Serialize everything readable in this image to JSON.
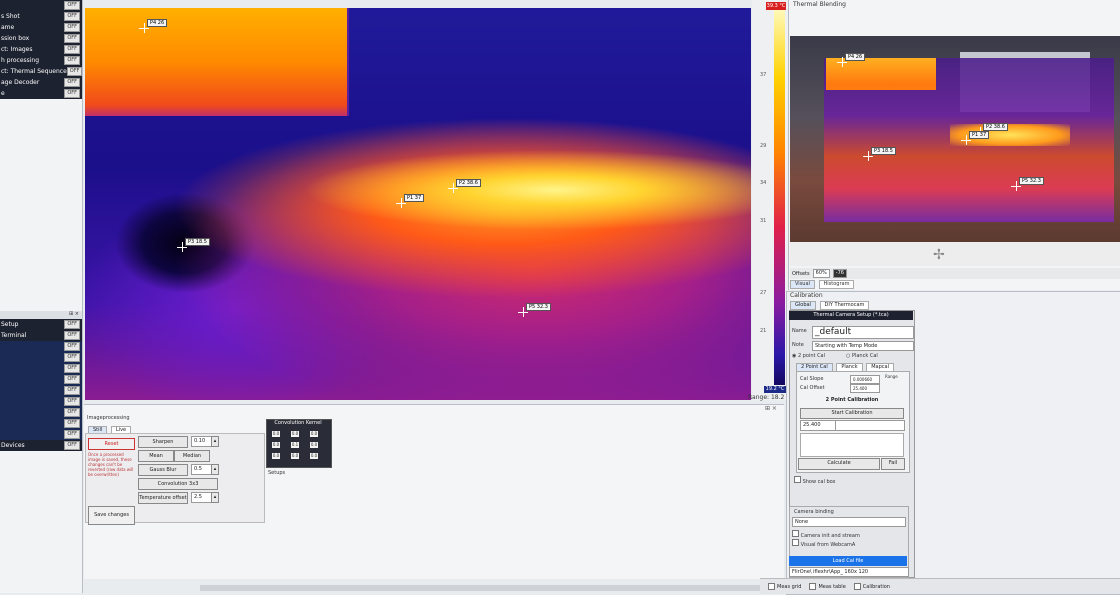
{
  "left_panel": {
    "items_top": [
      {
        "label": "",
        "state": "OFF"
      },
      {
        "label": "s Shot",
        "state": "OFF"
      },
      {
        "label": "ame",
        "state": "OFF"
      },
      {
        "label": "ssion box",
        "state": "OFF"
      },
      {
        "label": "ct: Images",
        "state": "OFF"
      },
      {
        "label": "h processing",
        "state": "OFF"
      },
      {
        "label": "ct: Thermal Sequence",
        "state": "OFF"
      },
      {
        "label": "age Decoder",
        "state": "OFF"
      },
      {
        "label": "e",
        "state": "OFF"
      }
    ],
    "items_bottom": [
      {
        "label": "Setup",
        "state": "OFF"
      },
      {
        "label": "Terminal",
        "state": "OFF"
      },
      {
        "label": "",
        "state": "OFF"
      },
      {
        "label": "",
        "state": "OFF"
      },
      {
        "label": "",
        "state": "OFF"
      },
      {
        "label": "",
        "state": "OFF"
      },
      {
        "label": "",
        "state": "OFF"
      },
      {
        "label": "",
        "state": "OFF"
      },
      {
        "label": "",
        "state": "OFF"
      },
      {
        "label": "",
        "state": "OFF"
      },
      {
        "label": "",
        "state": "OFF"
      },
      {
        "label": "Devices",
        "state": "OFF"
      }
    ]
  },
  "thermal_view": {
    "pins": [
      {
        "id": "P4",
        "label": "P4",
        "value": "26"
      },
      {
        "id": "P2",
        "label": "P2",
        "value": "38.6"
      },
      {
        "id": "P1",
        "label": "P1",
        "value": "37"
      },
      {
        "id": "P3",
        "label": "P3",
        "value": "18.5"
      },
      {
        "id": "P5",
        "label": "P5",
        "value": "32.3"
      }
    ]
  },
  "scale": {
    "max": "39.3 °C",
    "min": "19.2 °C",
    "ticks": [
      "37",
      "34",
      "29",
      "31",
      "27",
      "21"
    ],
    "range_label": "Range",
    "range_value": "18.2"
  },
  "blending": {
    "title": "Thermal Blending",
    "pins": [
      {
        "label": "P4",
        "value": "26"
      },
      {
        "label": "P2",
        "value": "38.6"
      },
      {
        "label": "P1",
        "value": "37"
      },
      {
        "label": "P3",
        "value": "18.5"
      },
      {
        "label": "P5",
        "value": "32.3"
      }
    ],
    "offsets_label": "Offsets",
    "offset_value": "60%",
    "zoom_value": "-76",
    "tabs": [
      "Visual",
      "Histogram"
    ]
  },
  "calibration": {
    "header": "Calibration",
    "tabs": [
      "Global",
      "DIY Thermocam"
    ],
    "box_title": "Thermal Camera Setup (*.tca)",
    "name_label": "Name",
    "name_value": "_default",
    "note_label": "Note",
    "note_value": "Starting with Temp Mode",
    "mode_options": [
      "2 point Cal",
      "Planck Cal"
    ],
    "subtabs": [
      "2 Point Cal",
      "Planck",
      "Mapcal"
    ],
    "cal_slope_label": "Cal Slope",
    "cal_slope_value": "0.000660",
    "cal_offset_label": "Cal Offset",
    "cal_offset_value": "25.400",
    "range_label": "Range",
    "section_title": "2 Point Calibration",
    "start_btn": "Start Calibration",
    "temp_value": "25.400",
    "calculate_btn": "Calculate",
    "fail_btn": "Fail",
    "show_cal_box": "Show cal box",
    "camera_binding_label": "Camera binding",
    "camera_binding_value": "None",
    "camera_init": "Camera init and stream",
    "visual_from": "Visual from WebcamA",
    "load_btn": "Load Cal file",
    "path_value": "FlirOne\\ iflexhr\\App_ 160x 120"
  },
  "image_processing": {
    "header": "Imageprocessing",
    "tabs": [
      "Still",
      "Live"
    ],
    "reset_btn": "Reset",
    "note": "Once a processed image is saved, these changes can't be reverted (raw data will be overwritten)",
    "save_btn": "Save changes",
    "controls": [
      {
        "label": "Sharpen",
        "value": "0.10"
      },
      {
        "label": "Mean",
        "value": ""
      },
      {
        "label": "Median",
        "value": ""
      },
      {
        "label": "Gauss Blur",
        "value": "0.5"
      },
      {
        "label": "Convolution 3x3",
        "value": ""
      },
      {
        "label": "Temperature offset",
        "value": "2.5"
      }
    ],
    "kernel_title": "Convolution Kernel",
    "kernel": [
      "0.0",
      "0.0",
      "0.0",
      "0.0",
      "0.1",
      "0.0",
      "0.0",
      "0.0",
      "0.0"
    ],
    "setups_label": "Setups"
  },
  "bottom_bar": {
    "items": [
      "Meas grid",
      "Meas table",
      "Calibration"
    ]
  }
}
